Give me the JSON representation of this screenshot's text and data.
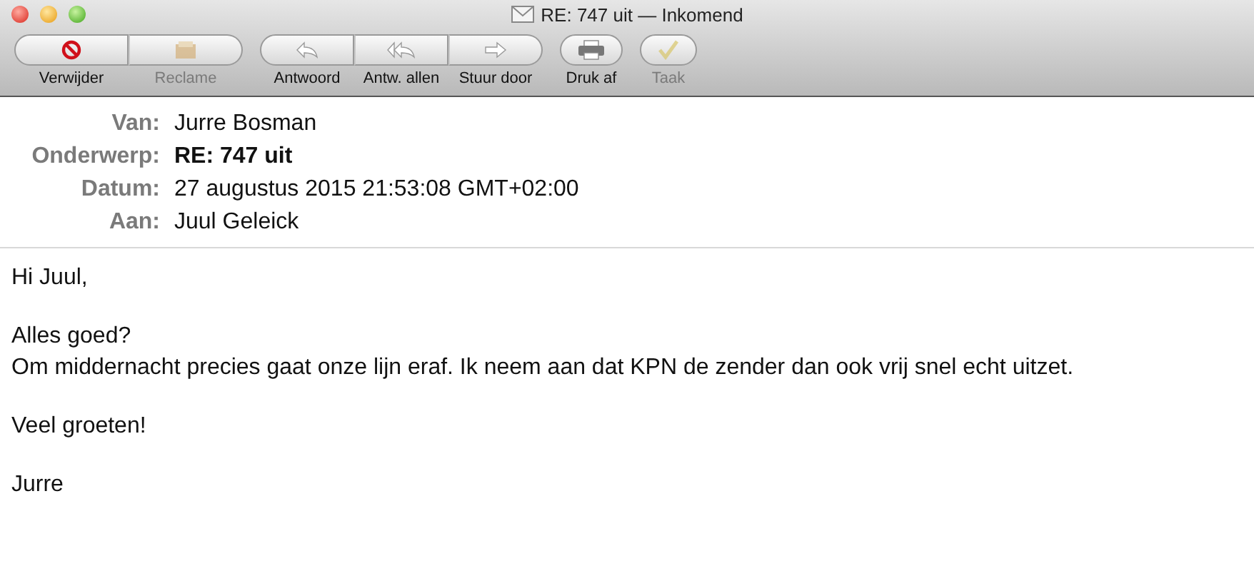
{
  "window": {
    "title": "RE: 747 uit  — Inkomend"
  },
  "toolbar": [
    [
      {
        "label": "Verwijder",
        "kind": "delete",
        "disabled": false
      },
      {
        "label": "Reclame",
        "kind": "junk",
        "disabled": true
      }
    ],
    [
      {
        "label": "Antwoord",
        "kind": "reply",
        "disabled": false
      },
      {
        "label": "Antw. allen",
        "kind": "reply-all",
        "disabled": false
      },
      {
        "label": "Stuur door",
        "kind": "forward",
        "disabled": false
      }
    ],
    [
      {
        "label": "Druk af",
        "kind": "print",
        "disabled": false
      }
    ],
    [
      {
        "label": "Taak",
        "kind": "todo",
        "disabled": true
      }
    ]
  ],
  "headers": [
    {
      "label": "Van:",
      "value": "Jurre Bosman",
      "bold": false
    },
    {
      "label": "Onderwerp:",
      "value": "RE: 747 uit",
      "bold": true
    },
    {
      "label": "Datum:",
      "value": "27 augustus 2015 21:53:08 GMT+02:00",
      "bold": false
    },
    {
      "label": "Aan:",
      "value": "Juul Geleick",
      "bold": false
    }
  ],
  "body": [
    [
      "Hi Juul,"
    ],
    [
      "Alles goed?",
      "Om middernacht precies gaat onze lijn eraf. Ik neem aan dat KPN de zender dan ook vrij snel echt uitzet."
    ],
    [
      "Veel groeten!"
    ],
    [
      "Jurre"
    ]
  ]
}
